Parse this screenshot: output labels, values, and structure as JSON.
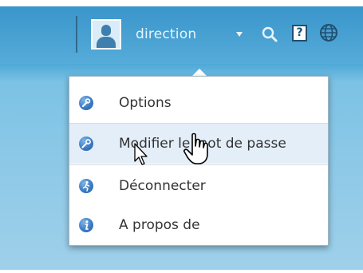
{
  "header": {
    "username": "direction",
    "icons": [
      "user-avatar",
      "chevron-down-icon",
      "search-icon",
      "help-icon",
      "globe-icon"
    ],
    "help_glyph": "?"
  },
  "menu": {
    "items": [
      {
        "label": "Options",
        "icon": "wrench-icon"
      },
      {
        "label": "Modifier le mot de passe",
        "icon": "key-icon"
      },
      {
        "label": "Déconnecter",
        "icon": "logout-icon"
      },
      {
        "label": "A propos de",
        "icon": "info-icon"
      }
    ],
    "hovered_index": 1
  },
  "colors": {
    "accent": "#3b7cc4",
    "topbar": "#4aa6d6",
    "hover": "#e4eef9"
  }
}
